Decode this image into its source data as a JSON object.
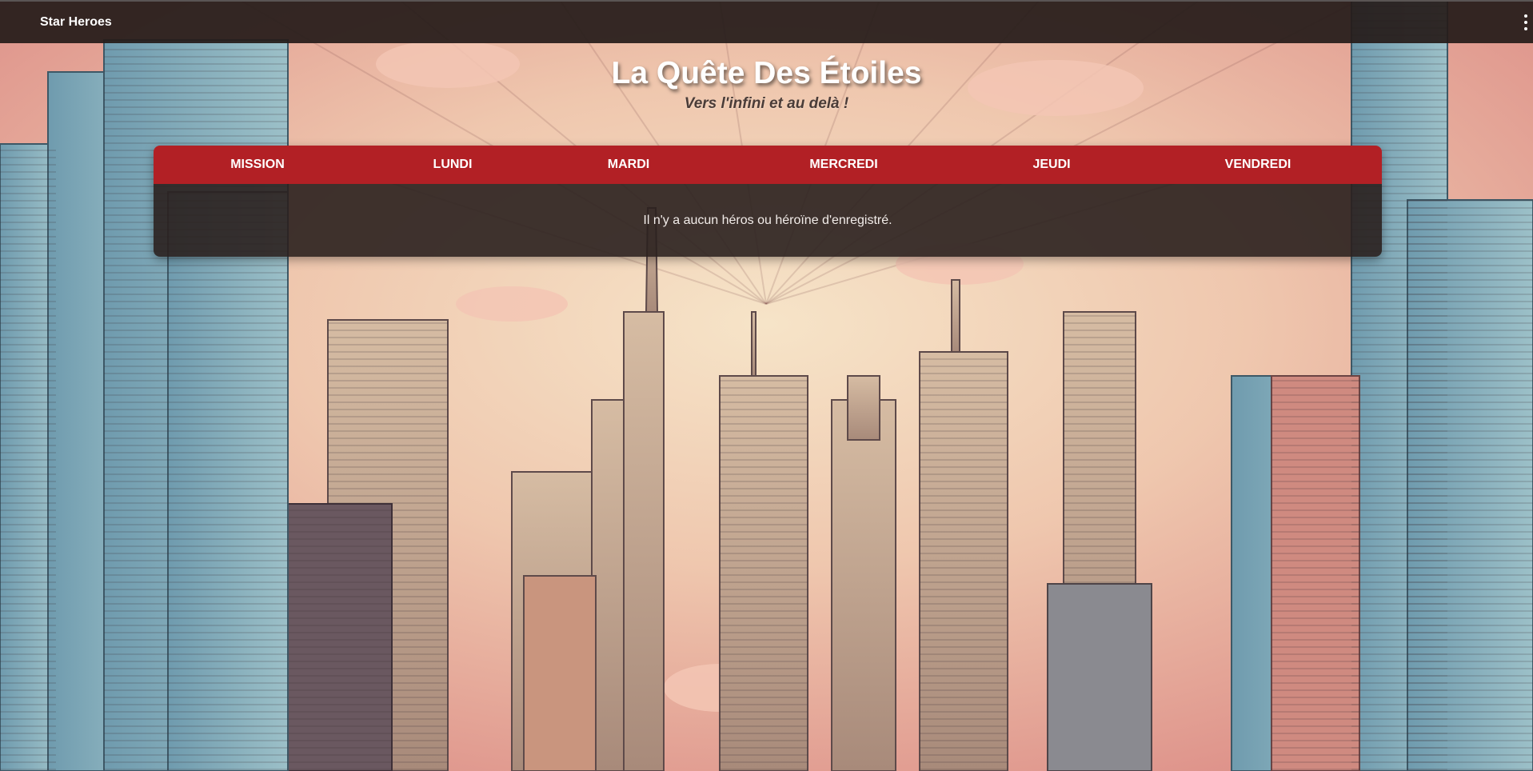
{
  "app": {
    "name": "Star Heroes"
  },
  "header": {
    "title": "La Quête Des Étoiles",
    "subtitle": "Vers l'infini et au delà !"
  },
  "table": {
    "columns": [
      "MISSION",
      "LUNDI",
      "MARDI",
      "MERCREDI",
      "JEUDI",
      "VENDREDI"
    ],
    "empty_message": "Il n'y a aucun héros ou héroïne d'enregistré."
  },
  "icons": {
    "menu": "more-vertical-icon"
  },
  "colors": {
    "accent": "#b22025",
    "topbar": "#261c1a",
    "panel_body": "#2a201e",
    "sky": "#e8b6a4"
  }
}
